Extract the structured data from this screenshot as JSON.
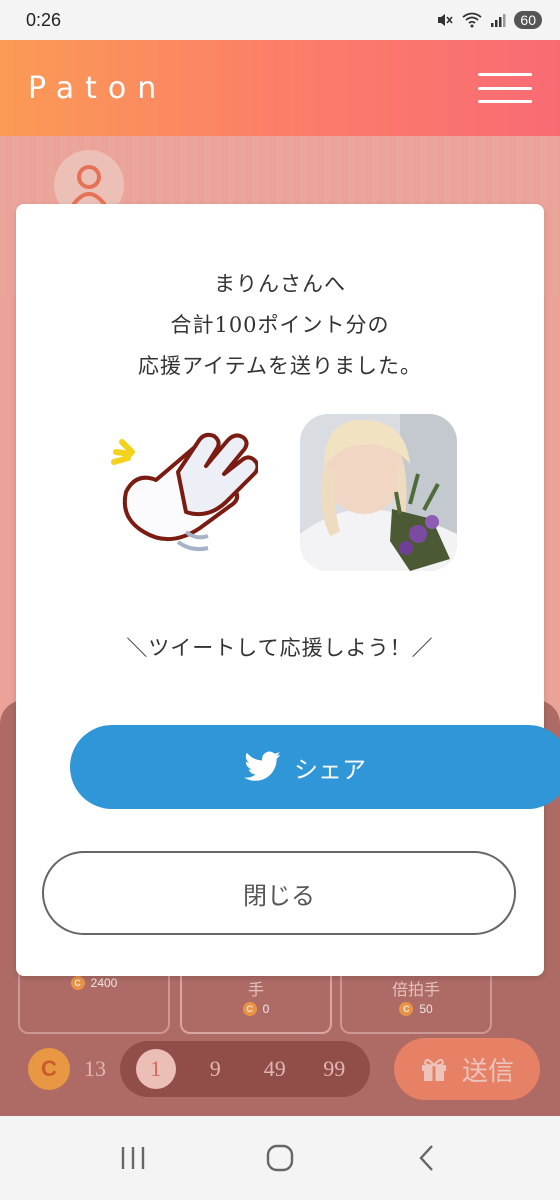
{
  "status_bar": {
    "time": "0:26",
    "battery": "60"
  },
  "header": {
    "logo": "Paton"
  },
  "modal": {
    "message_lines": [
      "まりんさんへ",
      "合計100ポイント分の",
      "応援アイテムを送りました。"
    ],
    "tweet_prompt": "＼ツイートして応援しよう！／",
    "share_label": "シェア",
    "close_label": "閉じる"
  },
  "items": [
    {
      "name": "",
      "cost": "2400"
    },
    {
      "name": "手",
      "cost": "0"
    },
    {
      "name": "倍拍手",
      "cost": "50"
    }
  ],
  "bottom_bar": {
    "coin_symbol": "C",
    "coin_count": "13",
    "quantities": [
      "1",
      "9",
      "49",
      "99"
    ],
    "selected_quantity": "1",
    "send_label": "送信"
  },
  "colors": {
    "header_start": "#fb9a55",
    "header_end": "#f96b74",
    "share": "#2f96d7",
    "coin": "#f8a445"
  }
}
